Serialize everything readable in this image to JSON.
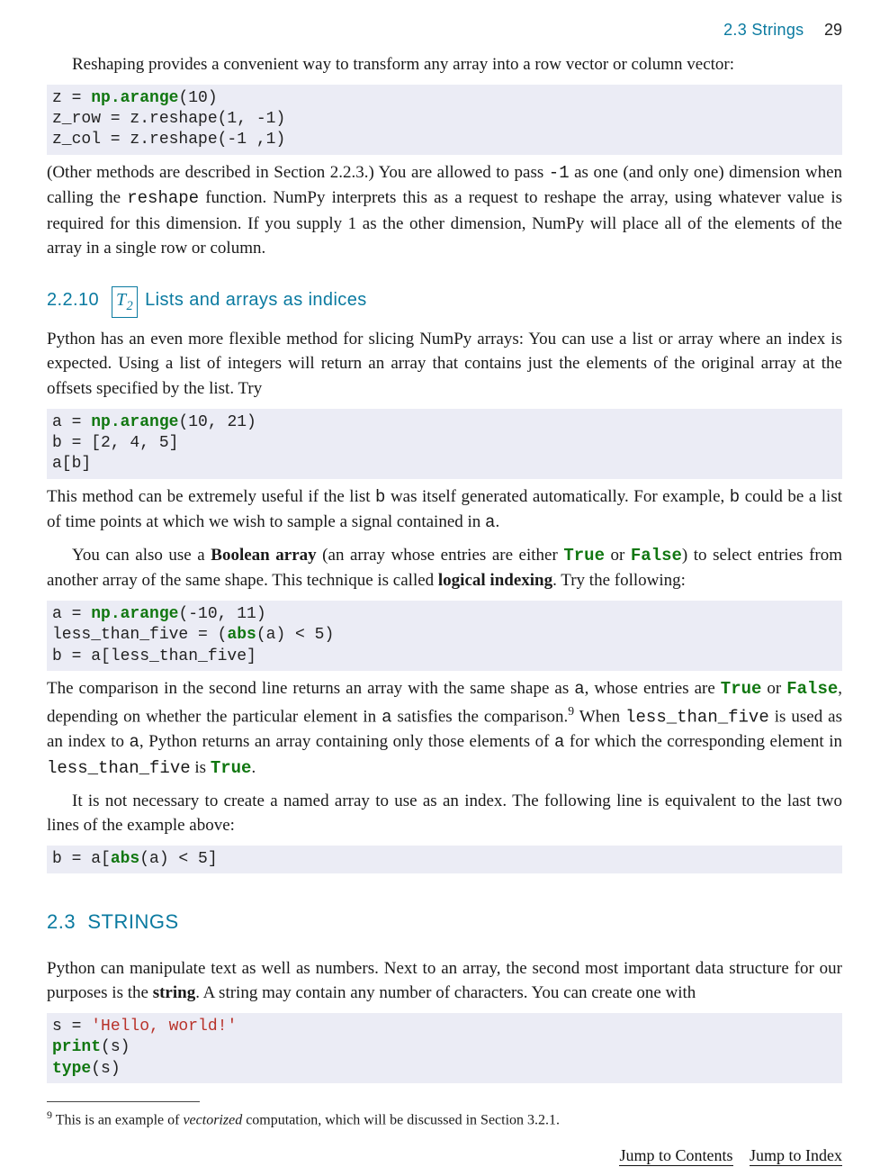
{
  "header": {
    "section": "2.3   Strings",
    "page": "29"
  },
  "p1_indent": "Reshaping provides a convenient way to transform any array into a row vector or column vector:",
  "code1": {
    "l1a": "z = ",
    "l1b": "np.arange",
    "l1c": "(10)",
    "l2": "z_row = z.reshape(1, -1)",
    "l3": "z_col = z.reshape(-1 ,1)"
  },
  "p2": {
    "a": "(Other methods are described in Section 2.2.3.) You are allowed to pass ",
    "b": "-1",
    "c": " as one (and only one) dimension when calling the ",
    "d": "reshape",
    "e": " function. NumPy interprets this as a request to reshape the array, using whatever value is required for this dimension. If you supply 1 as the other dimension, NumPy will place all of the elements of the array in a single row or column."
  },
  "sec2210": {
    "num": "2.2.10",
    "box": "T",
    "boxsub": "2",
    "title": "Lists and arrays as indices"
  },
  "p3": "Python has an even more flexible method for slicing NumPy arrays: You can use a list or array where an index is expected. Using a list of integers will return an array that contains just the elements of the original array at the offsets specified by the list. Try",
  "code2": {
    "l1a": "a = ",
    "l1b": "np.arange",
    "l1c": "(10, 21)",
    "l2": "b = [2, 4, 5]",
    "l3": "a[b]"
  },
  "p4": {
    "a": "This method can be extremely useful if the list ",
    "b": "b",
    "c": " was itself generated automatically. For example, ",
    "d": "b",
    "e": " could be a list of time points at which we wish to sample a signal contained in ",
    "f": "a",
    "g": "."
  },
  "p5": {
    "a": "You can also use a ",
    "b": "Boolean array",
    "c": " (an array whose entries are either ",
    "true": "True",
    "d": " or ",
    "false": "False",
    "e": ") to select entries from another array of the same shape. This technique is called ",
    "f": "logical indexing",
    "g": ". Try the following:"
  },
  "code3": {
    "l1a": "a = ",
    "l1b": "np.arange",
    "l1c": "(-10, 11)",
    "l2a": "less_than_five = (",
    "l2b": "abs",
    "l2c": "(a) < 5)",
    "l3": "b = a[less_than_five]"
  },
  "p6": {
    "a": "The comparison in the second line returns an array with the same shape as ",
    "b": "a",
    "c": ", whose entries are ",
    "true": "True",
    "d": " or ",
    "false": "False",
    "e": ", depending on whether the particular element in ",
    "f": "a",
    "g": " satisfies the comparison.",
    "fn": "9",
    "h": " When ",
    "i": "less_than_five",
    "j": " is used as an index to ",
    "k": "a",
    "l": ", Python returns an array containing only those elements of ",
    "m": "a",
    "n": " for which the corresponding element in ",
    "o": "less_than_five",
    "p": " is ",
    "true2": "True",
    "q": "."
  },
  "p7": "It is not necessary to create a named array to use as an index. The following line is equivalent to the last two lines of the example above:",
  "code4": {
    "a": "b = a[",
    "b": "abs",
    "c": "(a) < 5]"
  },
  "sec23": {
    "num": "2.3",
    "title": "STRINGS"
  },
  "p8": {
    "a": "Python can manipulate text as well as numbers. Next to an array, the second most important data structure for our purposes is the ",
    "b": "string",
    "c": ". A string may contain any number of characters. You can create one with"
  },
  "code5": {
    "l1a": "s = ",
    "l1b": "'Hello, world!'",
    "l2a": "print",
    "l2b": "(s)",
    "l3a": "type",
    "l3b": "(s)"
  },
  "footnote": {
    "num": "9",
    "a": " This is an example of ",
    "b": "vectorized",
    "c": " computation, which will be discussed in Section 3.2.1."
  },
  "footer": {
    "contents": "Jump to Contents",
    "index": "Jump to Index"
  }
}
